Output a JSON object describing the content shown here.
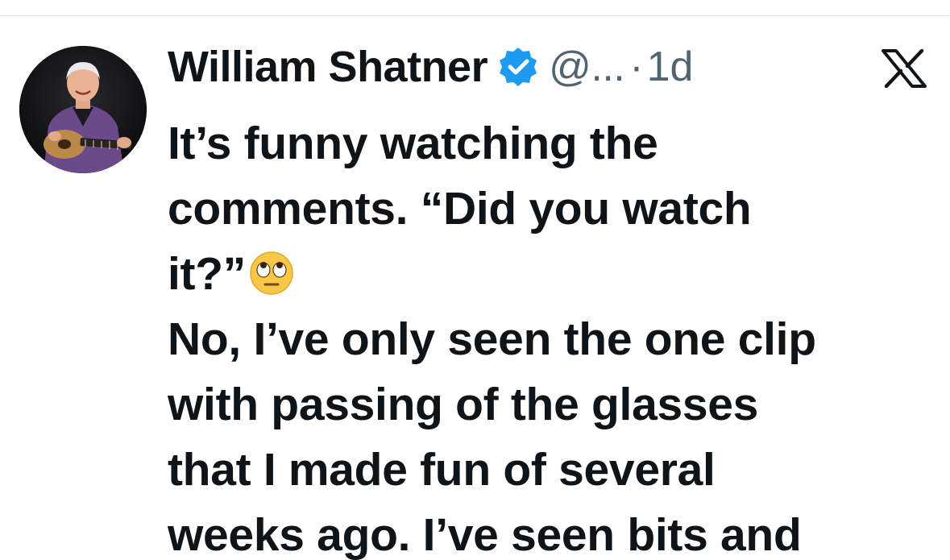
{
  "post": {
    "author_name": "William Shatner",
    "verified": true,
    "handle": "@...",
    "separator": "·",
    "timestamp": "1d",
    "lines": [
      "It’s funny watching the",
      "comments. “Did you watch",
      "it?”",
      "No, I’ve only seen the one clip",
      "with passing of the glasses",
      "that I made fun of several",
      "weeks ago. I’ve seen bits and"
    ],
    "emoji": "face-with-rolling-eyes"
  },
  "icons": {
    "verified": "verified-badge-icon",
    "platform": "x-logo-icon"
  },
  "colors": {
    "text": "#0f1419",
    "secondary": "#536471",
    "verified": "#1d9bf0",
    "divider": "#e3e6e8"
  }
}
